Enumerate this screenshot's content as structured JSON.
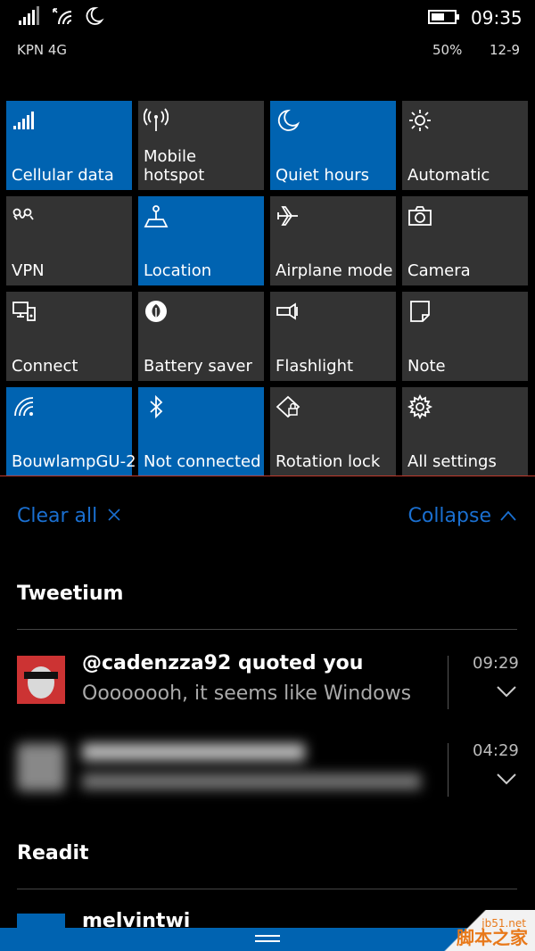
{
  "status_bar": {
    "carrier": "KPN 4G",
    "time": "09:35",
    "battery_percent": "50%",
    "battery_level": 0.5,
    "date": "12-9",
    "icons": [
      "signal-strength-icon",
      "wifi-icon",
      "quiet-hours-icon"
    ]
  },
  "tiles": [
    {
      "label": "Cellular data",
      "icon": "cellular-signal-icon",
      "active": true
    },
    {
      "label": "Mobile\nhotspot",
      "icon": "hotspot-icon",
      "active": false
    },
    {
      "label": "Quiet hours",
      "icon": "moon-icon",
      "active": true
    },
    {
      "label": "Automatic",
      "icon": "brightness-icon",
      "active": false
    },
    {
      "label": "VPN",
      "icon": "vpn-icon",
      "active": false
    },
    {
      "label": "Location",
      "icon": "location-icon",
      "active": true
    },
    {
      "label": "Airplane mode",
      "icon": "airplane-icon",
      "active": false
    },
    {
      "label": "Camera",
      "icon": "camera-icon",
      "active": false
    },
    {
      "label": "Connect",
      "icon": "connect-icon",
      "active": false
    },
    {
      "label": "Battery saver",
      "icon": "battery-saver-icon",
      "active": false
    },
    {
      "label": "Flashlight",
      "icon": "flashlight-icon",
      "active": false
    },
    {
      "label": "Note",
      "icon": "note-icon",
      "active": false
    },
    {
      "label": "BouwlampGU-2",
      "icon": "wifi-icon",
      "active": true
    },
    {
      "label": "Not connected",
      "icon": "bluetooth-icon",
      "active": true
    },
    {
      "label": "Rotation lock",
      "icon": "rotation-lock-icon",
      "active": false
    },
    {
      "label": "All settings",
      "icon": "gear-icon",
      "active": false
    }
  ],
  "actions": {
    "clear_all": "Clear all",
    "collapse": "Collapse"
  },
  "groups": [
    {
      "app": "Tweetium",
      "notifications": [
        {
          "title": "@cadenzza92 quoted you",
          "body": "Oooooooh, it seems like Windows",
          "time": "09:29",
          "blurred": false
        },
        {
          "title": "",
          "body": "",
          "time": "04:29",
          "blurred": true
        }
      ]
    },
    {
      "app": "Readit",
      "notifications": [
        {
          "title": "melvintwi",
          "body": "",
          "time": "",
          "blurred": false
        }
      ]
    }
  ],
  "watermark": {
    "line1": "jb51.net",
    "line2": "脚本之家"
  },
  "colors": {
    "accent": "#0063b1",
    "tile": "#333333",
    "link": "#1a6fd0"
  }
}
